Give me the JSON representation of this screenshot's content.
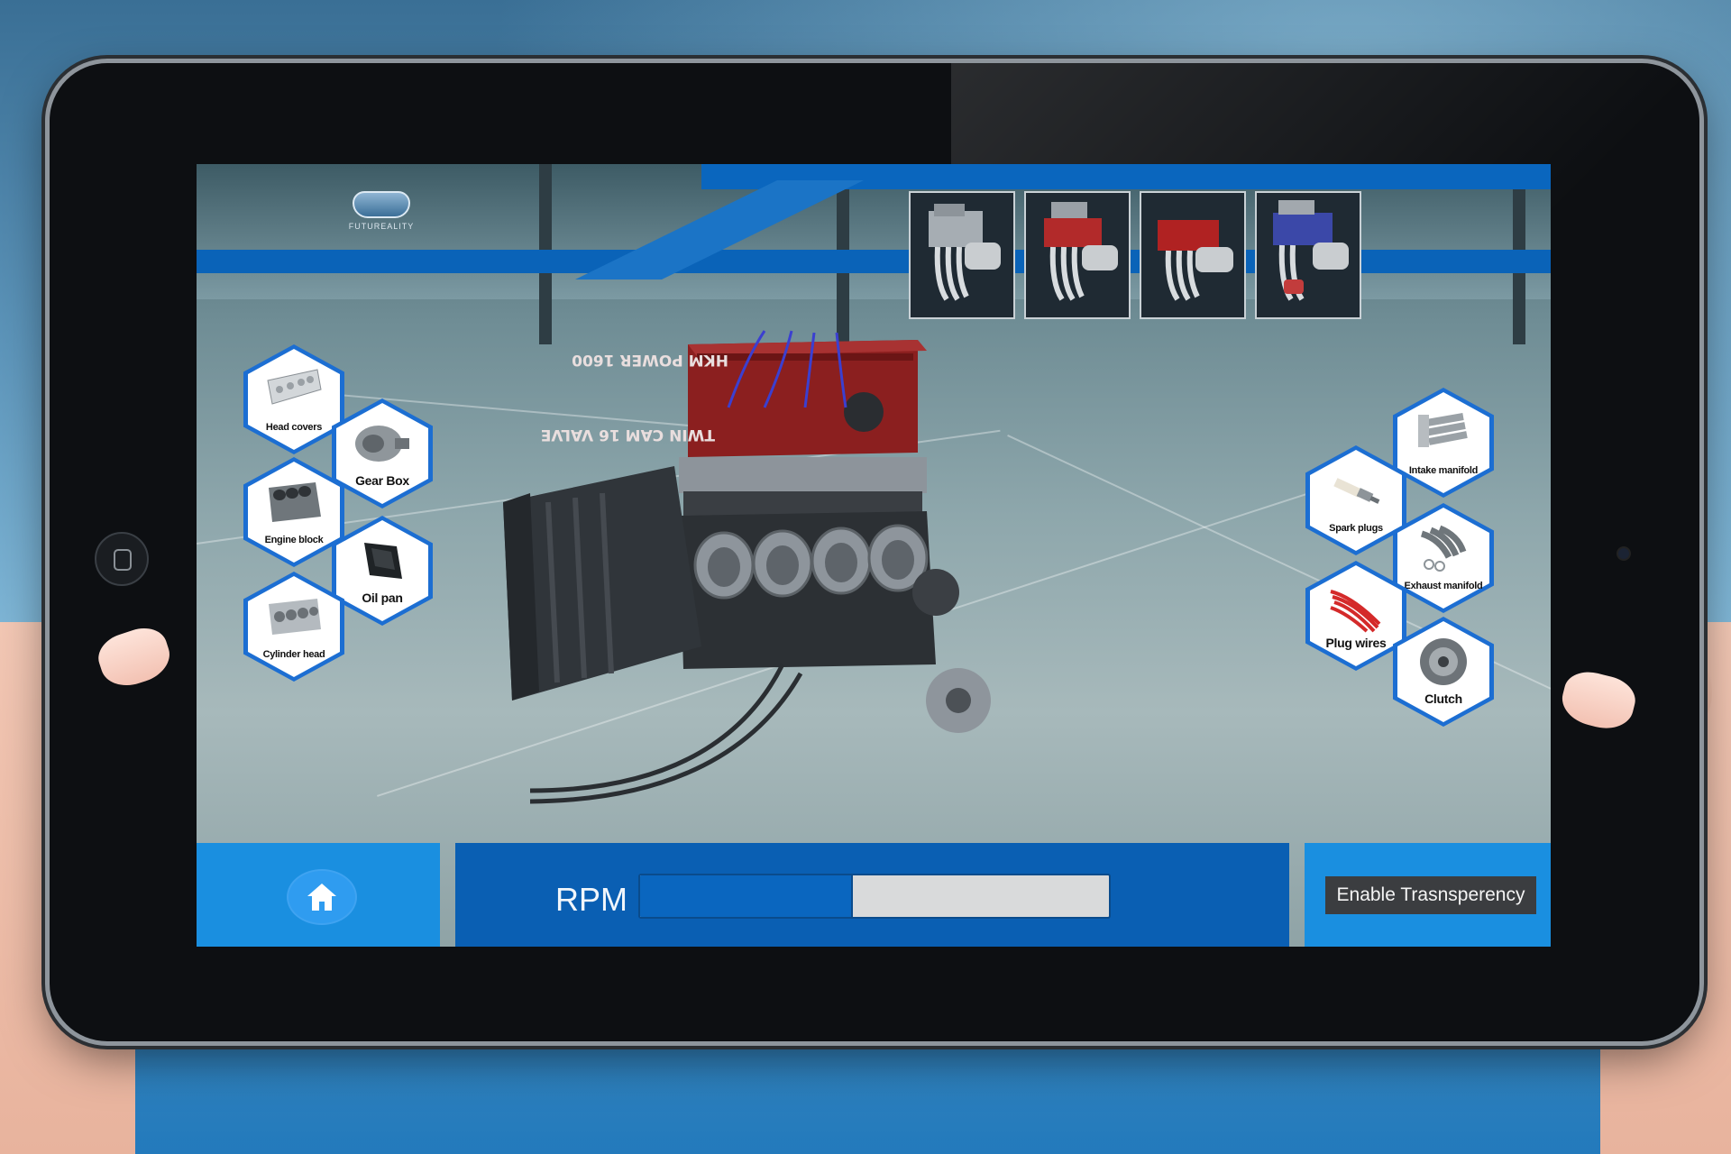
{
  "app": {
    "logo_text": "FUTUREALITY"
  },
  "thumbnails": [
    {
      "name": "engine-variant-silver"
    },
    {
      "name": "engine-variant-red-1"
    },
    {
      "name": "engine-variant-red-2"
    },
    {
      "name": "engine-variant-blue"
    }
  ],
  "engine_labels": {
    "cover_top": "HKM POWER 1600",
    "cover_bottom": "TWIN CAM 16 VALVE"
  },
  "parts_left": [
    {
      "label": "Head covers"
    },
    {
      "label": "Gear Box"
    },
    {
      "label": "Engine block"
    },
    {
      "label": "Oil pan"
    },
    {
      "label": "Cylinder head"
    }
  ],
  "parts_right": [
    {
      "label": "Intake manifold"
    },
    {
      "label": "Spark plugs"
    },
    {
      "label": "Exhaust manifold"
    },
    {
      "label": "Plug wires"
    },
    {
      "label": "Clutch"
    }
  ],
  "controls": {
    "rpm_label": "RPM",
    "rpm_fraction": 0.45,
    "transparency_button": "Enable Trasnsperency"
  },
  "colors": {
    "accent_blue": "#0a63b8",
    "light_blue": "#1a8fe0",
    "button_dark": "#3b3d40"
  }
}
